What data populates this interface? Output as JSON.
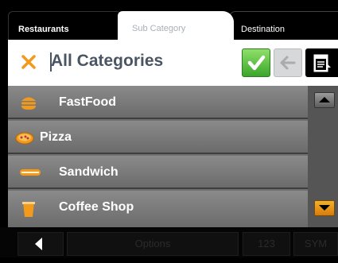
{
  "tabs": [
    {
      "label": "Restaurants"
    },
    {
      "label": "Sub Category"
    },
    {
      "label": "Destination"
    }
  ],
  "header": {
    "title": "All Categories"
  },
  "list": {
    "items": [
      {
        "label": "FastFood",
        "icon": "burger-icon"
      },
      {
        "label": "Pizza",
        "icon": "pizza-icon"
      },
      {
        "label": "Sandwich",
        "icon": "sandwich-icon"
      },
      {
        "label": "Coffee Shop",
        "icon": "coffee-cup-icon"
      }
    ]
  },
  "bottom_bar": {
    "options_label": "Options",
    "numbers_label": "123",
    "symbols_label": "SYM"
  },
  "colors": {
    "accent": "#f39a1a",
    "ok_green": "#3aa52a",
    "list_row": "#7a7a7a"
  }
}
